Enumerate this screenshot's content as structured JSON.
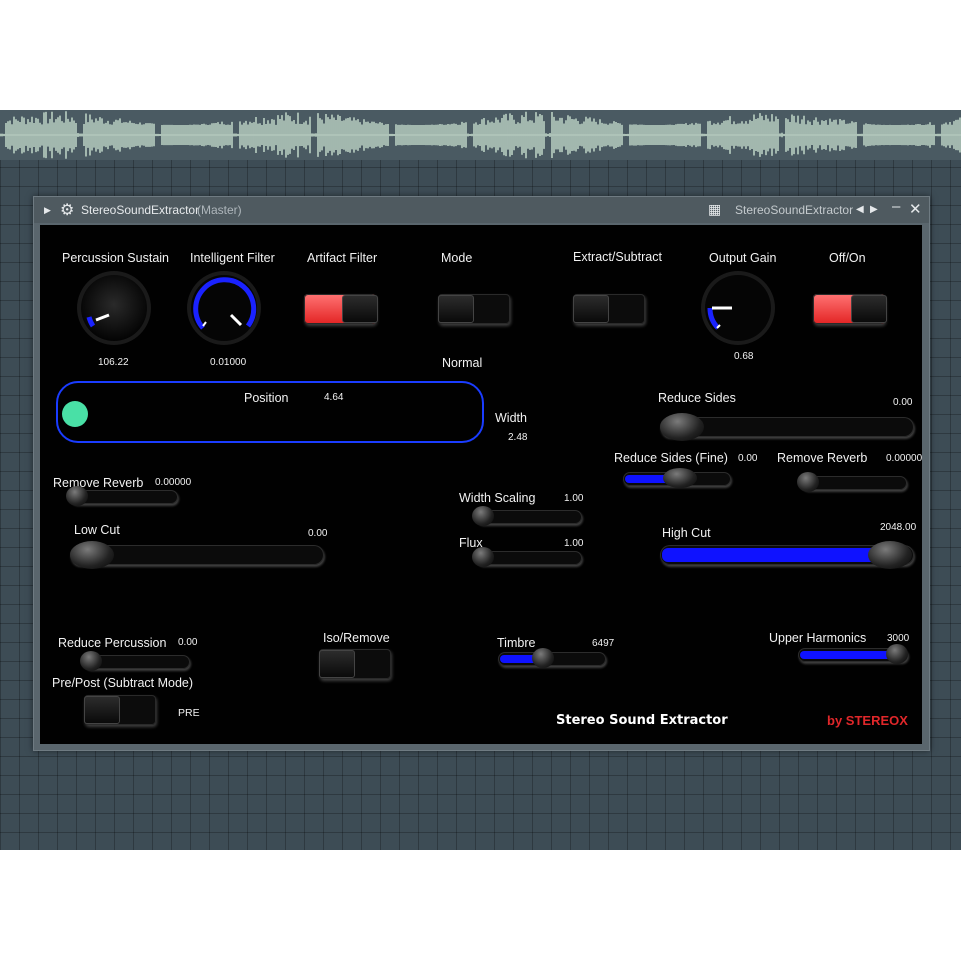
{
  "host": {
    "accent": "#3d4c55",
    "wave_color": "#b9cfc2"
  },
  "window": {
    "title": "StereoSoundExtractor",
    "subtitle": "(Master)",
    "preset_name": "StereoSoundExtractor",
    "icons": [
      "gear-icon",
      "piano-icon",
      "arrow-left-icon",
      "arrow-right-icon",
      "minimize-icon",
      "close-icon"
    ]
  },
  "controls": {
    "percussion_sustain": {
      "label": "Percussion Sustain",
      "value": "106.22"
    },
    "intelligent_filter": {
      "label": "Intelligent Filter",
      "value": "0.01000"
    },
    "artifact_filter": {
      "label": "Artifact Filter",
      "on": true
    },
    "mode": {
      "label": "Mode",
      "state": "Normal"
    },
    "extract_subtract": {
      "label": "Extract/Subtract"
    },
    "output_gain": {
      "label": "Output Gain",
      "value": "0.68"
    },
    "off_on": {
      "label": "Off/On",
      "on": true
    },
    "position": {
      "label": "Position",
      "value": "4.64"
    },
    "width": {
      "label": "Width",
      "value": "2.48"
    },
    "reduce_sides": {
      "label": "Reduce Sides",
      "value": "0.00"
    },
    "reduce_sides_fine": {
      "label": "Reduce Sides (Fine)",
      "value": "0.00"
    },
    "remove_reverb_right": {
      "label": "Remove Reverb",
      "value": "0.00000"
    },
    "remove_reverb_left": {
      "label": "Remove Reverb",
      "value": "0.00000"
    },
    "width_scaling": {
      "label": "Width Scaling",
      "value": "1.00"
    },
    "flux": {
      "label": "Flux",
      "value": "1.00"
    },
    "low_cut": {
      "label": "Low Cut",
      "value": "0.00"
    },
    "high_cut": {
      "label": "High Cut",
      "value": "2048.00"
    },
    "reduce_percussion": {
      "label": "Reduce Percussion",
      "value": "0.00"
    },
    "iso_remove": {
      "label": "Iso/Remove"
    },
    "timbre": {
      "label": "Timbre",
      "value": "6497"
    },
    "upper_harmonics": {
      "label": "Upper Harmonics",
      "value": "3000"
    },
    "pre_post": {
      "label": "Pre/Post (Subtract Mode)",
      "state": "PRE"
    }
  },
  "branding": {
    "product": "Stereo Sound Extractor",
    "vendor": "by STEREOX"
  }
}
